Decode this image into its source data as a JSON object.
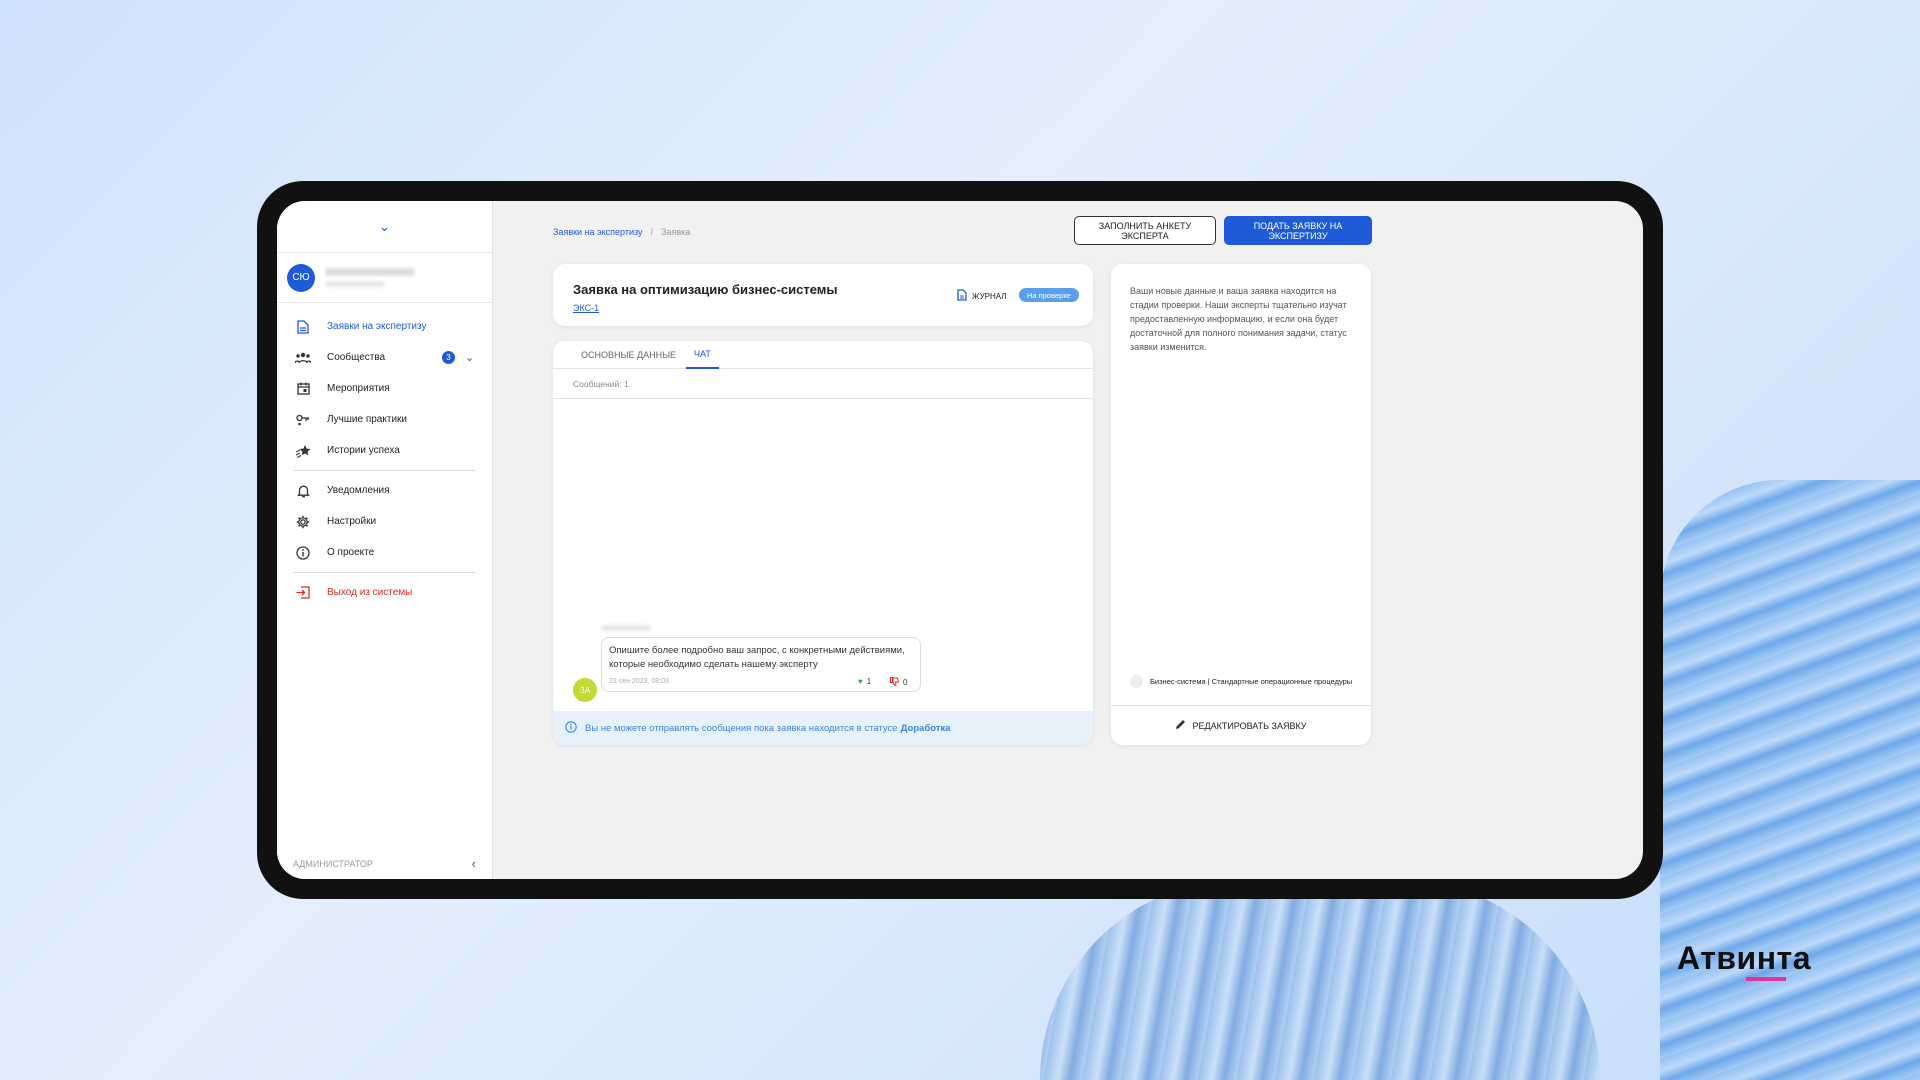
{
  "brand": "Атвинта",
  "sidebar": {
    "user_initials": "СЮ",
    "items": [
      {
        "label": "Заявки на экспертизу",
        "icon": "document-icon"
      },
      {
        "label": "Сообщества",
        "icon": "community-icon",
        "badge": "3"
      },
      {
        "label": "Мероприятия",
        "icon": "calendar-icon"
      },
      {
        "label": "Лучшие практики",
        "icon": "key-icon"
      },
      {
        "label": "Истории успеха",
        "icon": "star-icon"
      },
      {
        "label": "Уведомления",
        "icon": "bell-icon"
      },
      {
        "label": "Настройки",
        "icon": "gear-icon"
      },
      {
        "label": "О проекте",
        "icon": "info-icon"
      },
      {
        "label": "Выход из системы",
        "icon": "logout-icon"
      }
    ],
    "role": "АДМИНИСТРАТОР"
  },
  "breadcrumb": {
    "parent": "Заявки на экспертизу",
    "current": "Заявка"
  },
  "toolbar": {
    "fill_expert_form": "ЗАПОЛНИТЬ АНКЕТУ ЭКСПЕРТА",
    "submit_request": "ПОДАТЬ ЗАЯВКУ НА ЭКСПЕРТИЗУ"
  },
  "request": {
    "title": "Заявка на оптимизацию бизнес-системы",
    "code": "ЭКС-1",
    "journal_label": "ЖУРНАЛ",
    "status": "На проверке"
  },
  "chat": {
    "tabs": [
      "ОСНОВНЫЕ ДАННЫЕ",
      "ЧАТ"
    ],
    "message_count": "Сообщений: 1",
    "message": {
      "avatar_initials": "ЗА",
      "text": "Опишите более подробно ваш запрос, с конкретными действиями, которые необходимо сделать нашему эксперту",
      "time": "23 сен 2023, 08:03",
      "likes": "1",
      "dislikes": "0"
    },
    "notice_text": "Вы не можете отправлять сообщения пока заявка находится в статусе",
    "notice_status": "Доработка"
  },
  "info": {
    "text": "Ваши новые данные и ваша заявка находится на стадии проверки. Наши эксперты тщательно изучат предоставленную информацию, и если она будет достаточной для полного понимания задачи, статус заявки изменится.",
    "system_link": "Бизнес-система | Стандартные операционные процедуры",
    "edit_label": "РЕДАКТИРОВАТЬ ЗАЯВКУ"
  }
}
